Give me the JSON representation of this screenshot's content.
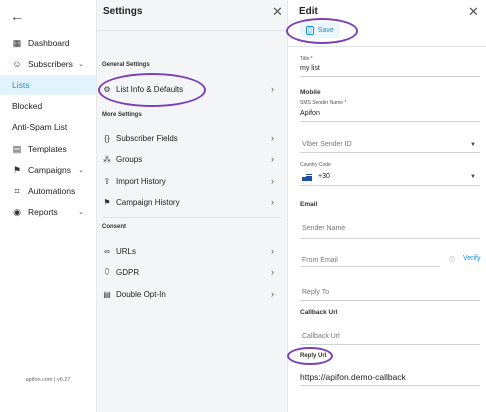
{
  "sidebar": {
    "back_icon": "arrow-left-icon",
    "items": [
      {
        "label": "Dashboard",
        "icon": "grid-icon",
        "glyph": "▦"
      },
      {
        "label": "Subscribers",
        "icon": "users-icon",
        "glyph": "☺",
        "chevron": "⌄"
      },
      {
        "label": "Lists",
        "active": true
      },
      {
        "label": "Blocked"
      },
      {
        "label": "Anti-Spam List"
      },
      {
        "label": "Templates",
        "icon": "templates-icon",
        "glyph": "▤"
      },
      {
        "label": "Campaigns",
        "icon": "flag-icon",
        "glyph": "⚑",
        "chevron": "⌄"
      },
      {
        "label": "Automations",
        "icon": "automation-icon",
        "glyph": "⌗"
      },
      {
        "label": "Reports",
        "icon": "reports-icon",
        "glyph": "◉",
        "chevron": "⌄"
      }
    ],
    "footer": "apifon.com | v6.27"
  },
  "settings": {
    "title": "Settings",
    "sections": {
      "general": "General Settings",
      "more": "More Settings",
      "consent": "Consent"
    },
    "items": {
      "list_info": "List Info & Defaults",
      "subscriber_fields": "Subscriber Fields",
      "groups": "Groups",
      "import_history": "Import History",
      "campaign_history": "Campaign History",
      "urls": "URLs",
      "gdpr": "GDPR",
      "double_opt_in": "Double Opt-In"
    }
  },
  "edit": {
    "title": "Edit",
    "save_label": "Save",
    "title_label": "Title *",
    "title_value": "my list",
    "mobile_head": "Mobile",
    "sms_sender_label": "SMS Sender Name *",
    "sms_sender_value": "Apifon",
    "viber_placeholder": "Viber Sender ID",
    "country_code_label": "Country Code",
    "country_code_value": "+30",
    "email_head": "Email",
    "sender_name_placeholder": "Sender Name",
    "from_email_placeholder": "From Email",
    "verify_label": "Verify",
    "reply_to_placeholder": "Reply To",
    "callback_head": "Callback Url",
    "callback_placeholder": "Callback Url",
    "reply_url_label": "Reply Url",
    "reply_url_value": "https://apifon.demo-callback"
  },
  "colors": {
    "accent": "#1a8fd6",
    "highlight": "#7b3fb8",
    "active_bg": "#e3f3fc"
  }
}
